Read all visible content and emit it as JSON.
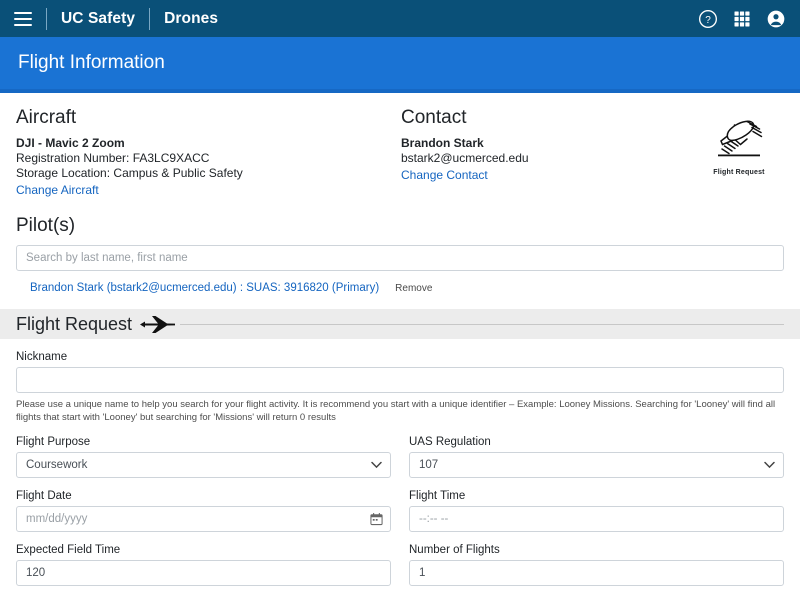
{
  "topbar": {
    "menu_icon": "hamburger-menu-icon",
    "brand_primary": "UC Safety",
    "brand_secondary": "Drones",
    "help_icon": "help-circle-icon",
    "apps_icon": "apps-grid-icon",
    "account_icon": "user-account-icon",
    "background": "#0a5078"
  },
  "banner": {
    "title": "Flight Information",
    "background": "#1a73d4"
  },
  "aircraft": {
    "heading": "Aircraft",
    "model": "DJI - Mavic 2 Zoom",
    "registration": "Registration Number: FA3LC9XACC",
    "storage": "Storage Location: Campus & Public Safety",
    "change_link": "Change Aircraft"
  },
  "contact": {
    "heading": "Contact",
    "name": "Brandon Stark",
    "email": "bstark2@ucmerced.edu",
    "change_link": "Change Contact"
  },
  "logo": {
    "icon": "airplane-speed-lines-icon",
    "caption": "Flight Request"
  },
  "pilots": {
    "heading": "Pilot(s)",
    "search_placeholder": "Search by last name, first name",
    "search_value": "",
    "entries": [
      {
        "label": "Brandon Stark (bstark2@ucmerced.edu) : SUAS: 3916820 (Primary)",
        "remove_label": "Remove"
      }
    ]
  },
  "flight_request": {
    "band_title": "Flight Request",
    "band_icon": "airplane-icon",
    "nickname": {
      "label": "Nickname",
      "value": "",
      "placeholder": "",
      "helper": "Please use a unique name to help you search for your flight activity. It is recommend you start with a unique identifier – Example: Looney Missions. Searching for 'Looney' will find all flights that start with 'Looney' but searching for 'Missions' will return 0 results"
    },
    "flight_purpose": {
      "label": "Flight Purpose",
      "value": "Coursework",
      "options": [
        "Coursework"
      ]
    },
    "uas_regulation": {
      "label": "UAS Regulation",
      "value": "107",
      "options": [
        "107"
      ]
    },
    "flight_date": {
      "label": "Flight Date",
      "value": "",
      "placeholder": "mm/dd/yyyy",
      "picker_icon": "calendar-icon"
    },
    "flight_time": {
      "label": "Flight Time",
      "value": "",
      "placeholder": "--:-- --"
    },
    "expected_field_time": {
      "label": "Expected Field Time",
      "value": "120"
    },
    "number_of_flights": {
      "label": "Number of Flights",
      "value": "1"
    }
  }
}
